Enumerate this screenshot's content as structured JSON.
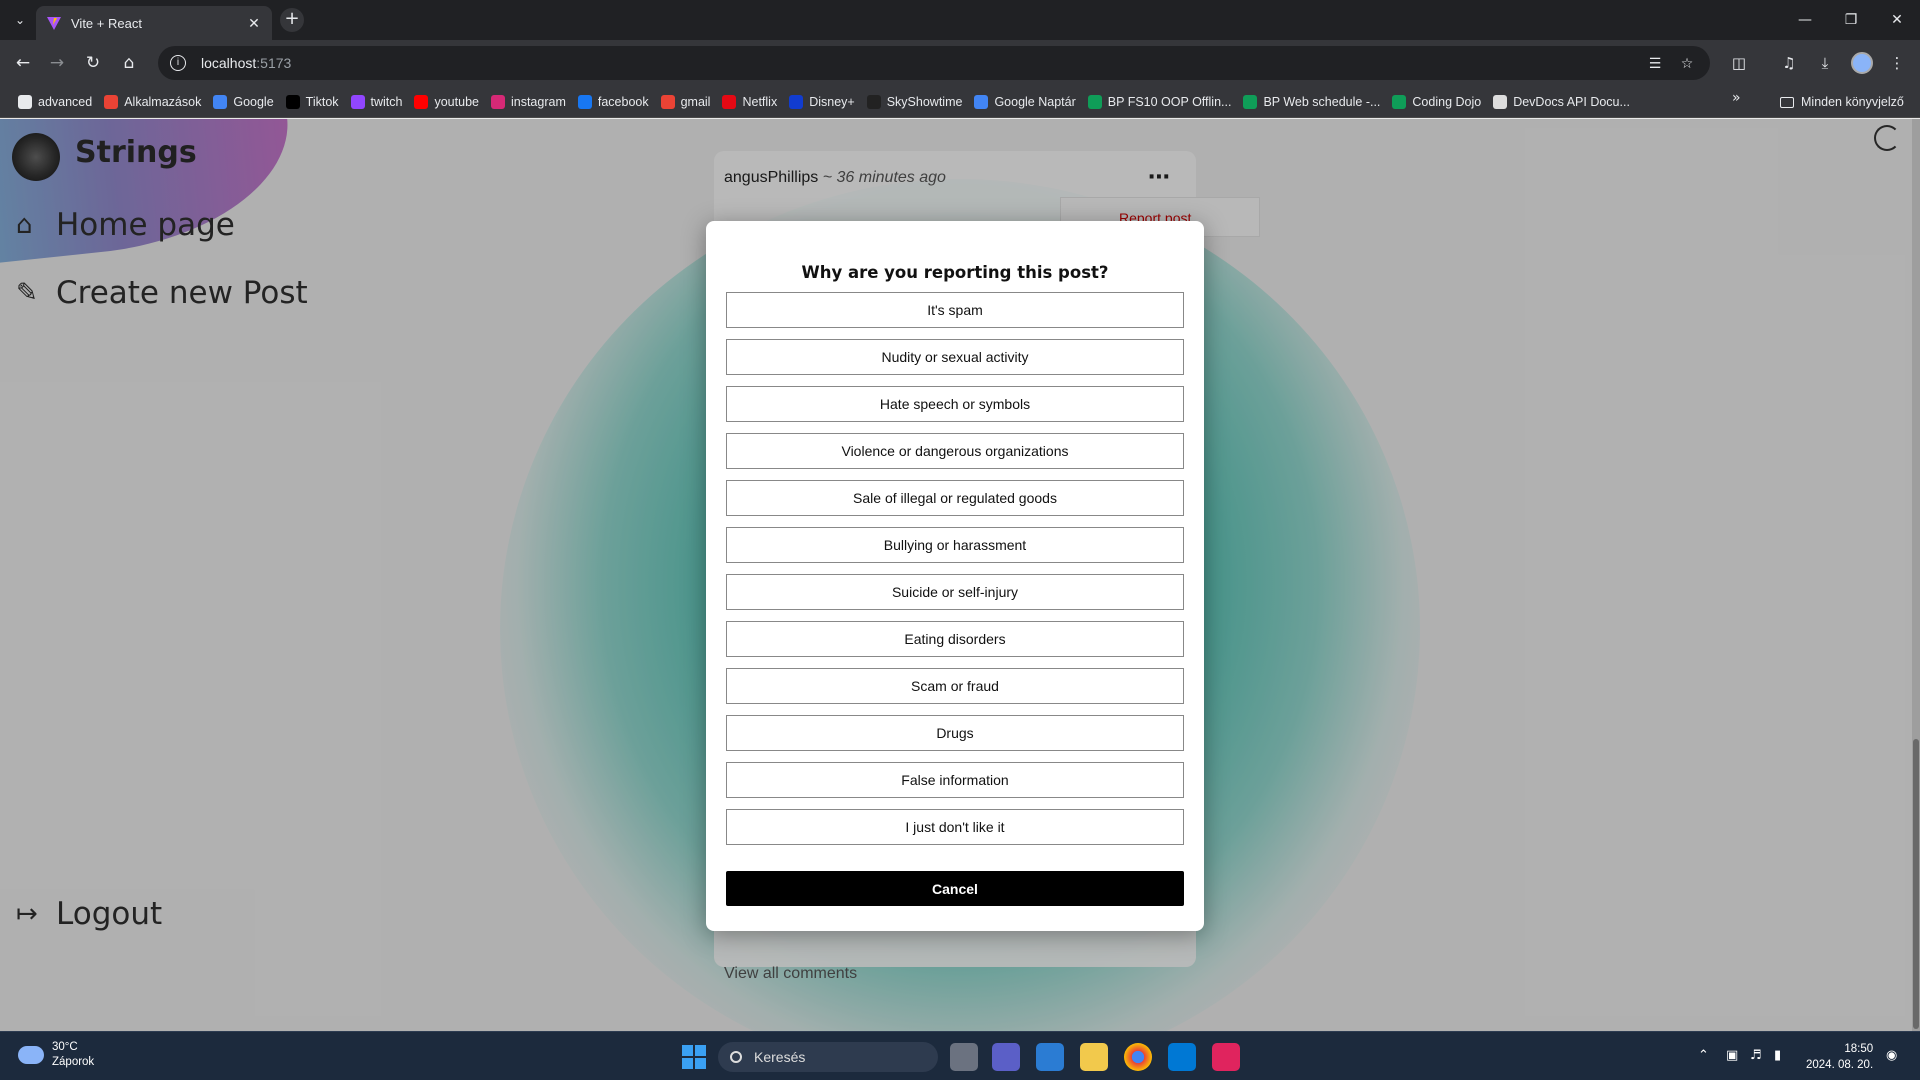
{
  "browser": {
    "tab_title": "Vite + React",
    "url_host": "localhost",
    "url_port": ":5173",
    "bookmarks": [
      {
        "label": "advanced",
        "icon": "folder-icon",
        "color": "#e8eaed"
      },
      {
        "label": "Alkalmazások",
        "icon": "apps-icon",
        "color": "#ea4335"
      },
      {
        "label": "Google",
        "icon": "google-icon",
        "color": "#4285f4"
      },
      {
        "label": "Tiktok",
        "icon": "tiktok-icon",
        "color": "#000000"
      },
      {
        "label": "twitch",
        "icon": "twitch-icon",
        "color": "#9146ff"
      },
      {
        "label": "youtube",
        "icon": "youtube-icon",
        "color": "#ff0000"
      },
      {
        "label": "instagram",
        "icon": "instagram-icon",
        "color": "#d62976"
      },
      {
        "label": "facebook",
        "icon": "facebook-icon",
        "color": "#1877f2"
      },
      {
        "label": "gmail",
        "icon": "gmail-icon",
        "color": "#ea4335"
      },
      {
        "label": "Netflix",
        "icon": "netflix-icon",
        "color": "#e50914"
      },
      {
        "label": "Disney+",
        "icon": "disney-icon",
        "color": "#113ccf"
      },
      {
        "label": "SkyShowtime",
        "icon": "skyshowtime-icon",
        "color": "#222222"
      },
      {
        "label": "Google Naptár",
        "icon": "calendar-icon",
        "color": "#4285f4"
      },
      {
        "label": "BP FS10 OOP Offlin...",
        "icon": "sheets-icon",
        "color": "#0f9d58"
      },
      {
        "label": "BP Web schedule -...",
        "icon": "sheets-icon",
        "color": "#0f9d58"
      },
      {
        "label": "Coding Dojo",
        "icon": "sheets-icon",
        "color": "#0f9d58"
      },
      {
        "label": "DevDocs API Docu...",
        "icon": "devdocs-icon",
        "color": "#dddddd"
      }
    ],
    "all_bookmarks": "Minden könyvjelző"
  },
  "app": {
    "logo_text": "Strings",
    "nav": {
      "home": "Home page",
      "create": "Create new Post",
      "logout": "Logout"
    }
  },
  "post": {
    "author": "angusPhillips",
    "time": " ~ 36 minutes ago",
    "menu_item": "Report post",
    "view_comments": "View all comments"
  },
  "modal": {
    "title": "Why are you reporting this post?",
    "reasons": [
      "It's spam",
      "Nudity or sexual activity",
      "Hate speech or symbols",
      "Violence or dangerous organizations",
      "Sale of illegal or regulated goods",
      "Bullying or harassment",
      "Suicide or self-injury",
      "Eating disorders",
      "Scam or fraud",
      "Drugs",
      "False information",
      "I just don't like it"
    ],
    "cancel": "Cancel"
  },
  "taskbar": {
    "temperature": "30°C",
    "weather": "Záporok",
    "search": "Keresés",
    "time": "18:50",
    "date": "2024. 08. 20."
  }
}
